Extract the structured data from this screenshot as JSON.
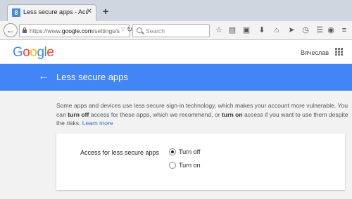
{
  "browser": {
    "tab_title": "Less secure apps - Account s...",
    "tab_favicon": "8",
    "tab_close": "✕",
    "new_tab": "+",
    "url_prefix": "https://www.",
    "url_domain": "google.com",
    "url_suffix": "/settings/securit",
    "search_placeholder": "Search"
  },
  "header": {
    "logo": [
      "G",
      "o",
      "o",
      "g",
      "l",
      "e"
    ],
    "logo_colors": [
      "#4285f4",
      "#ea4335",
      "#fbbc05",
      "#4285f4",
      "#34a853",
      "#ea4335"
    ],
    "username": "Вячеслав"
  },
  "banner": {
    "title": "Less secure apps",
    "color": "#4285f4"
  },
  "description": {
    "part1": "Some apps and devices use less secure sign-in technology, which makes your account more vulnerable. You can ",
    "bold1": "turn off",
    "part2": " access for these apps, which we recommend, or ",
    "bold2": "turn on",
    "part3": " access if you want to use them despite the risks. ",
    "link": "Learn more"
  },
  "access": {
    "label": "Access for less secure apps",
    "options": [
      {
        "label": "Turn off",
        "selected": true
      },
      {
        "label": "Turn on",
        "selected": false
      }
    ]
  }
}
